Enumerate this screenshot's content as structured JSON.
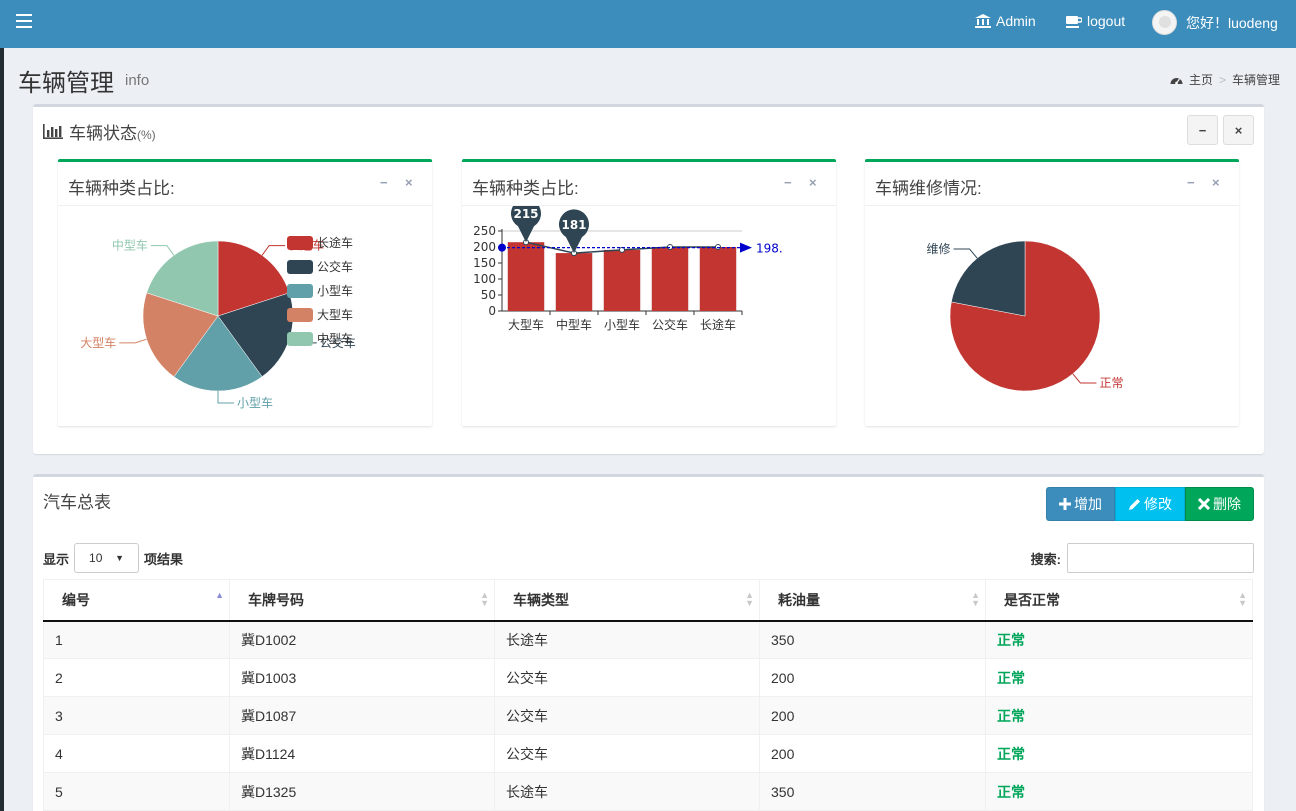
{
  "header": {
    "admin_label": "Admin",
    "logout_label": "logout",
    "greeting": "您好！luodeng"
  },
  "page": {
    "title": "车辆管理",
    "subtitle": "info",
    "breadcrumb": [
      "主页",
      "车辆管理"
    ]
  },
  "status_box": {
    "title": "车辆状态",
    "unit": "(%)",
    "collapse_symbol": "−",
    "close_symbol": "×"
  },
  "panels": [
    {
      "title": "车辆种类占比:"
    },
    {
      "title": "车辆种类占比:"
    },
    {
      "title": "车辆维修情况:"
    }
  ],
  "panel_tools": {
    "minus": "−",
    "close": "×"
  },
  "colors": {
    "header": "#3c8dbc",
    "panel_accent": "#00a65a",
    "red": "#c23531",
    "navy": "#2f4554",
    "teal": "#61a0a8",
    "orange": "#d48265",
    "green": "#91c7ae",
    "marker": "#2f4554",
    "avg_line": "#0000cc",
    "ok_text": "#00a65a"
  },
  "chart_data": [
    {
      "type": "pie",
      "title": "车辆种类占比:",
      "legend": [
        "长途车",
        "公交车",
        "小型车",
        "大型车",
        "中型车"
      ],
      "slices": [
        {
          "label": "长途车",
          "value": 20
        },
        {
          "label": "公交车",
          "value": 20
        },
        {
          "label": "小型车",
          "value": 20
        },
        {
          "label": "大型车",
          "value": 20
        },
        {
          "label": "中型车",
          "value": 20
        }
      ]
    },
    {
      "type": "bar",
      "title": "车辆种类占比:",
      "categories": [
        "大型车",
        "中型车",
        "小型车",
        "公交车",
        "长途车"
      ],
      "values": [
        215,
        181,
        191,
        200,
        200
      ],
      "ylim": [
        0,
        250
      ],
      "yticks": [
        0,
        50,
        100,
        150,
        200,
        250
      ],
      "max_label": "215",
      "min_label": "181",
      "avg_label": "198.",
      "avg_value": 198
    },
    {
      "type": "pie",
      "title": "车辆维修情况:",
      "slices": [
        {
          "label": "正常",
          "value": 78
        },
        {
          "label": "维修",
          "value": 22
        }
      ]
    }
  ],
  "table_box": {
    "title": "汽车总表",
    "add_label": "增加",
    "edit_label": "修改",
    "delete_label": "删除",
    "show_label": "显示",
    "page_size": "10",
    "result_label": "项结果",
    "search_label": "搜索:",
    "columns": [
      "编号",
      "车牌号码",
      "车辆类型",
      "耗油量",
      "是否正常"
    ],
    "rows": [
      [
        "1",
        "冀D1002",
        "长途车",
        "350",
        "正常"
      ],
      [
        "2",
        "冀D1003",
        "公交车",
        "200",
        "正常"
      ],
      [
        "3",
        "冀D1087",
        "公交车",
        "200",
        "正常"
      ],
      [
        "4",
        "冀D1124",
        "公交车",
        "200",
        "正常"
      ],
      [
        "5",
        "冀D1325",
        "长途车",
        "350",
        "正常"
      ]
    ]
  }
}
